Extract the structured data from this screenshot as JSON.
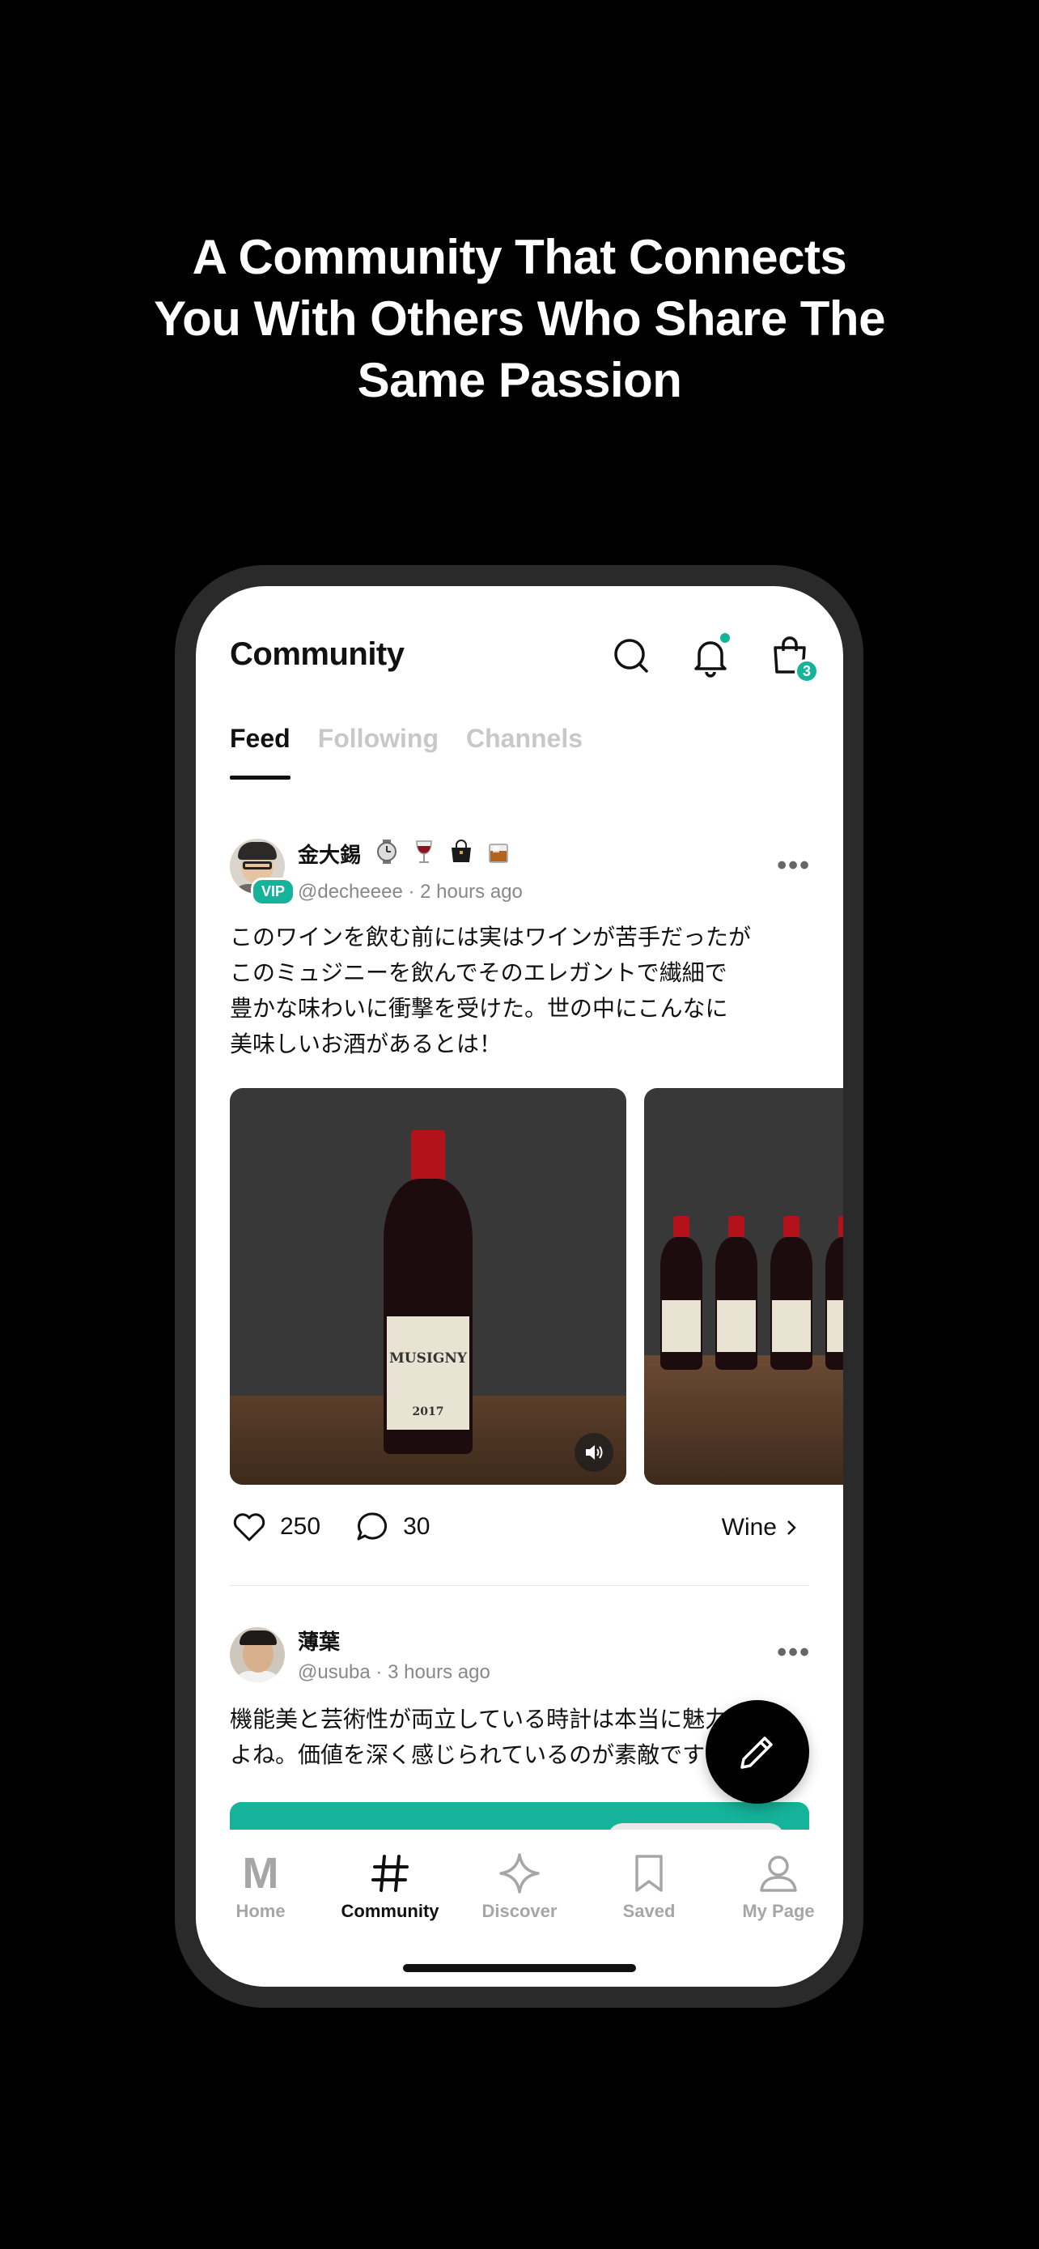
{
  "headline": {
    "line1": "A Community That Connects",
    "line2": "You With Others Who Share The",
    "line3": "Same Passion"
  },
  "header": {
    "title": "Community",
    "cart_count": "3"
  },
  "tabs": [
    {
      "label": "Feed",
      "active": true
    },
    {
      "label": "Following",
      "active": false
    },
    {
      "label": "Channels",
      "active": false
    }
  ],
  "posts": [
    {
      "username": "金大錫",
      "vip": "VIP",
      "handle": "@decheeee",
      "time": "2 hours ago",
      "meta": "@decheeee · 2 hours ago",
      "badges": [
        "watch-icon",
        "wine-glass-icon",
        "handbag-icon",
        "whisky-icon"
      ],
      "text": [
        "このワインを飲む前には実はワインが苦手だったが",
        "このミュジニーを飲んでそのエレガントで繊細で",
        "豊かな味わいに衝撃を受けた。世の中にこんなに",
        "美味しいお酒があるとは！"
      ],
      "image_label": "MUSIGNY",
      "vintage": "2017",
      "likes": "250",
      "comments": "30",
      "channel": "Wine"
    },
    {
      "username": "薄葉",
      "handle": "@usuba",
      "time": "3 hours ago",
      "meta": "@usuba · 3 hours ago",
      "text": [
        "機能美と芸術性が両立している時計は本当に魅力です",
        "よね。価値を深く感じられているのが素敵です"
      ]
    }
  ],
  "nav": [
    {
      "label": "Home",
      "icon": "m-logo-icon",
      "active": false
    },
    {
      "label": "Community",
      "icon": "hash-icon",
      "active": true
    },
    {
      "label": "Discover",
      "icon": "sparkle-icon",
      "active": false
    },
    {
      "label": "Saved",
      "icon": "bookmark-icon",
      "active": false
    },
    {
      "label": "My Page",
      "icon": "person-icon",
      "active": false
    }
  ],
  "colors": {
    "accent": "#14b39a",
    "background": "#000000",
    "text": "#111111",
    "muted": "#a6a6a6"
  }
}
